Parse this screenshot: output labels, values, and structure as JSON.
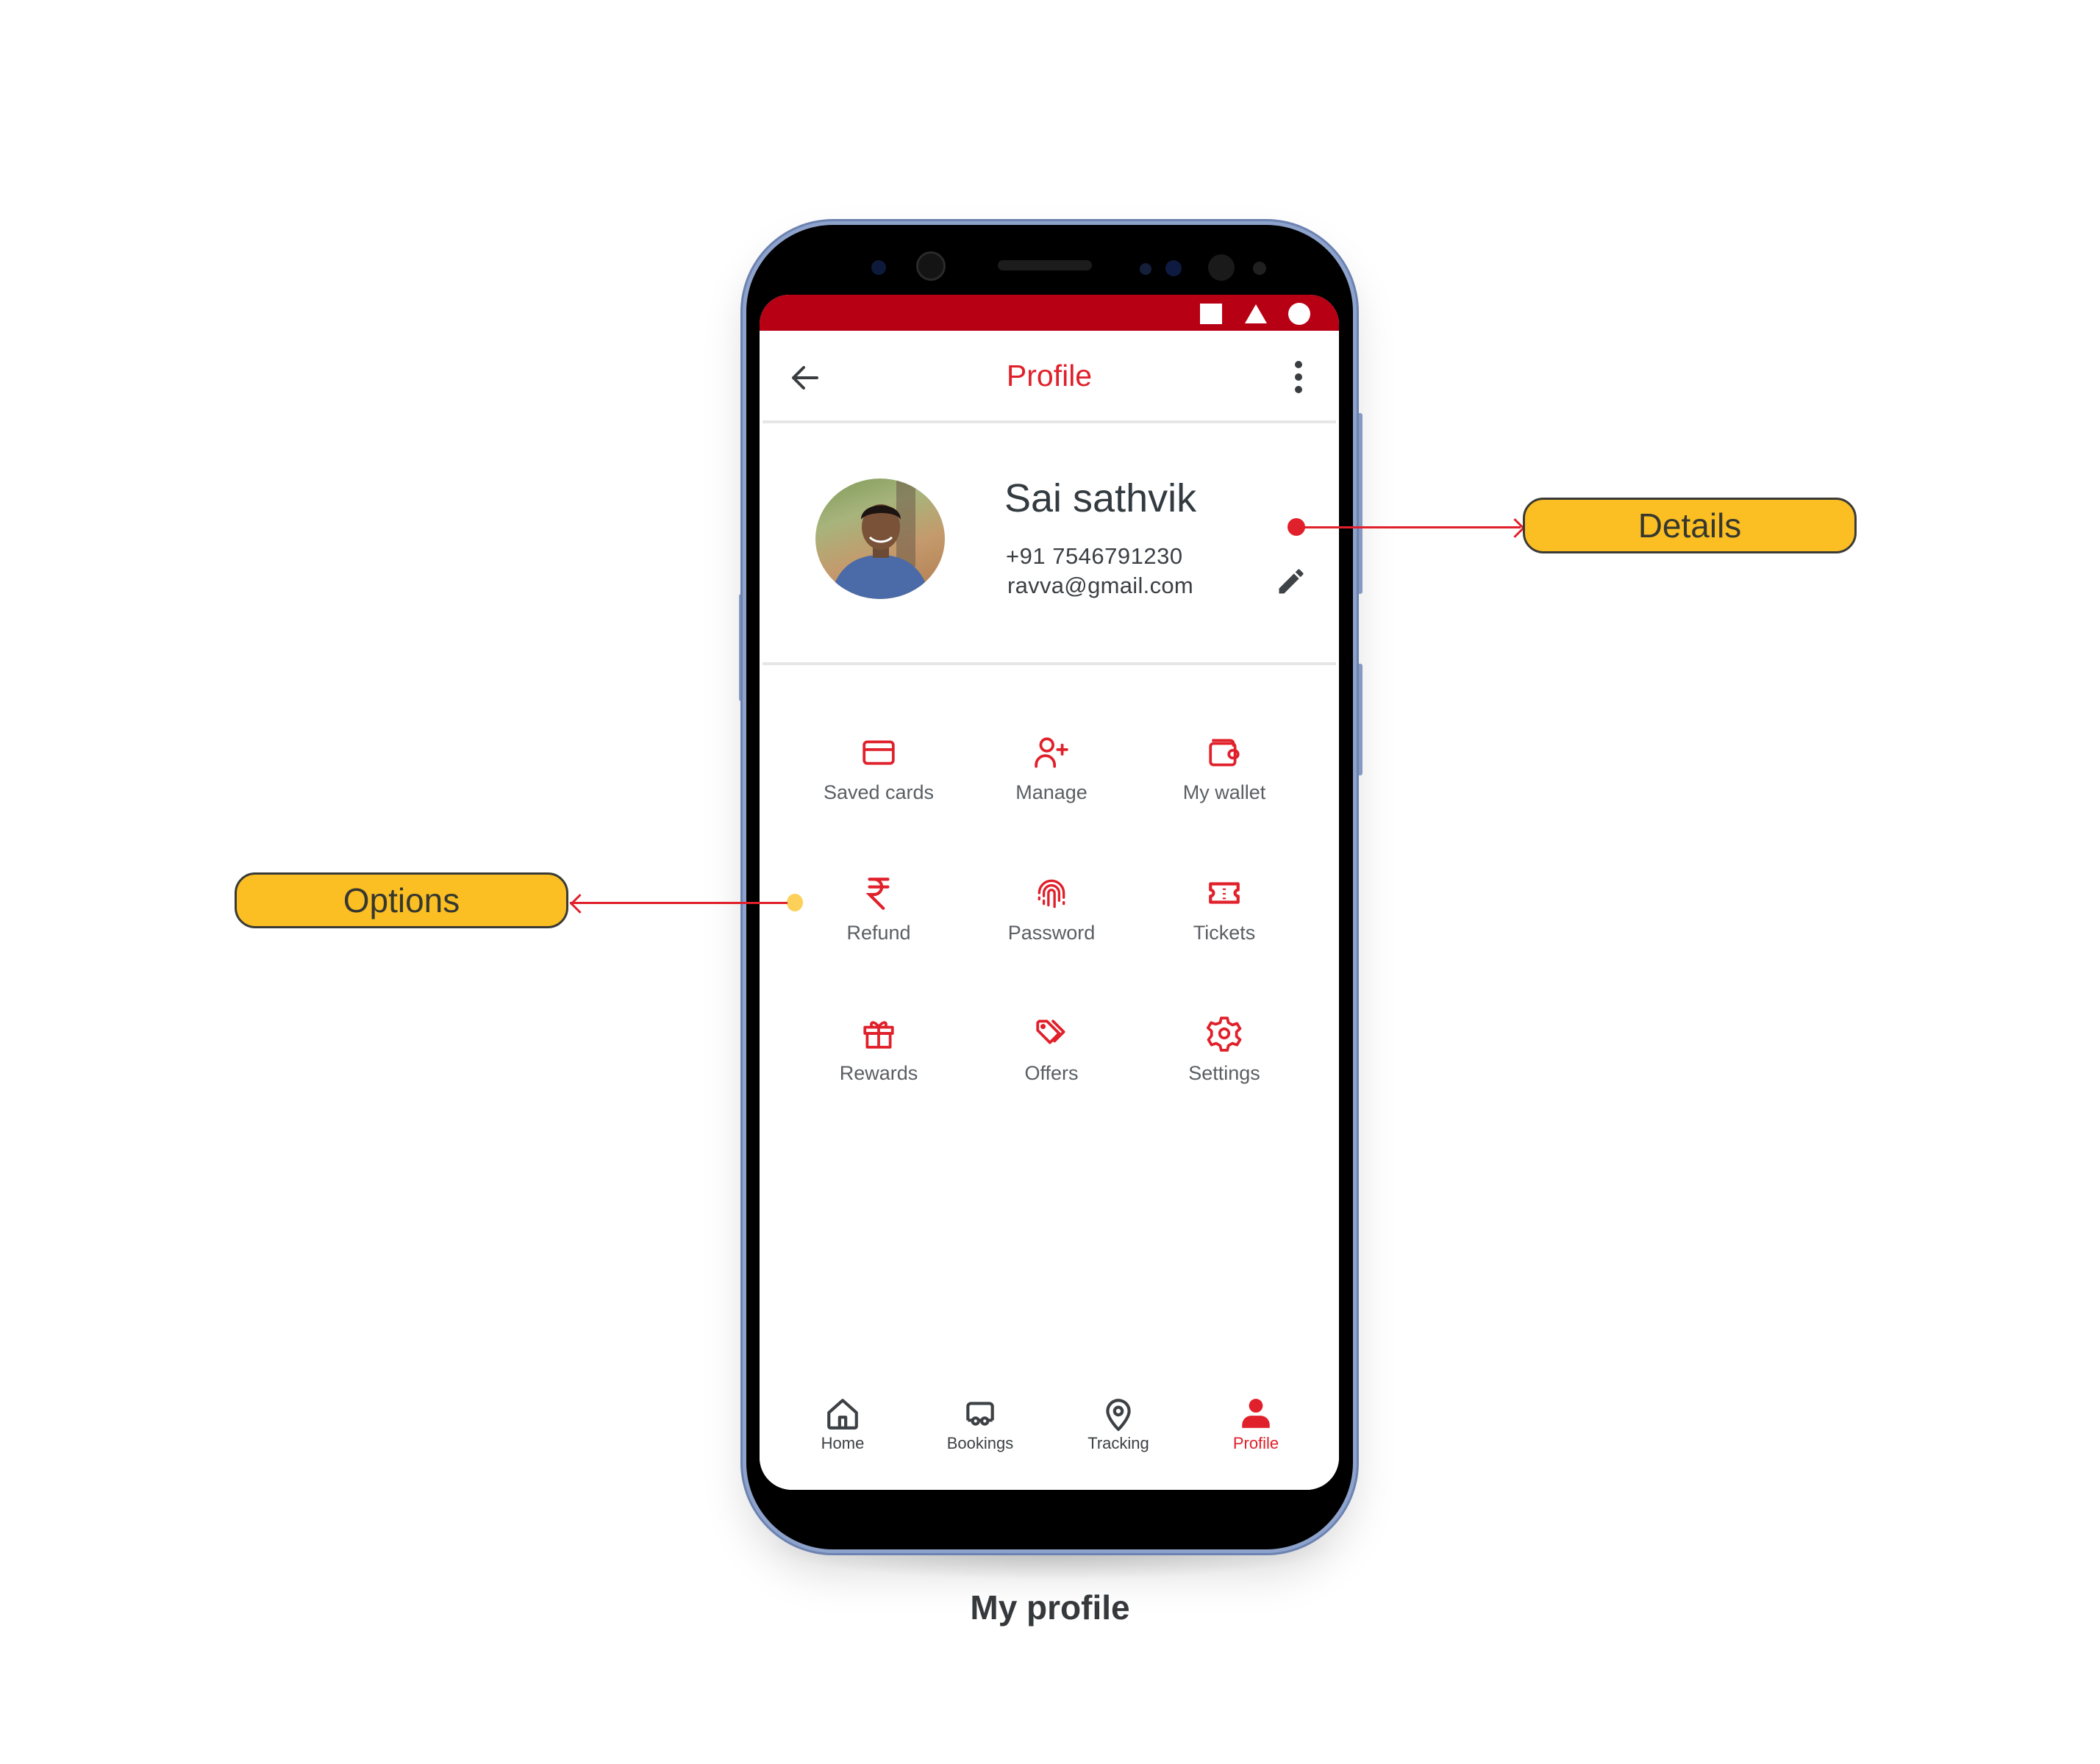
{
  "caption": "My profile",
  "colors": {
    "primary": "#e0202a",
    "status_bar": "#b80015",
    "callout_fill": "#fbbf24",
    "text_dark": "#333b40",
    "text_muted": "#5a5e62"
  },
  "status_bar": {
    "icons": [
      "square-icon",
      "triangle-icon",
      "circle-icon"
    ]
  },
  "app_bar": {
    "title": "Profile",
    "back_icon": "arrow-left-icon",
    "menu_icon": "more-vertical-icon"
  },
  "profile": {
    "name": "Sai sathvik",
    "phone": "+91 7546791230",
    "email": "ravva@gmail.com",
    "edit_icon": "pencil-icon",
    "avatar_alt": "Profile photo"
  },
  "options": [
    {
      "label": "Saved cards",
      "icon": "credit-card-icon"
    },
    {
      "label": "Manage",
      "icon": "user-plus-icon"
    },
    {
      "label": "My wallet",
      "icon": "wallet-icon"
    },
    {
      "label": "Refund",
      "icon": "rupee-icon"
    },
    {
      "label": "Password",
      "icon": "fingerprint-icon"
    },
    {
      "label": "Tickets",
      "icon": "ticket-icon"
    },
    {
      "label": "Rewards",
      "icon": "gift-icon"
    },
    {
      "label": "Offers",
      "icon": "tags-icon"
    },
    {
      "label": "Settings",
      "icon": "gear-icon"
    }
  ],
  "bottom_nav": [
    {
      "label": "Home",
      "icon": "home-icon",
      "active": false
    },
    {
      "label": "Bookings",
      "icon": "bus-icon",
      "active": false
    },
    {
      "label": "Tracking",
      "icon": "map-pin-icon",
      "active": false
    },
    {
      "label": "Profile",
      "icon": "user-icon",
      "active": true
    }
  ],
  "annotations": {
    "details": "Details",
    "options": "Options"
  }
}
